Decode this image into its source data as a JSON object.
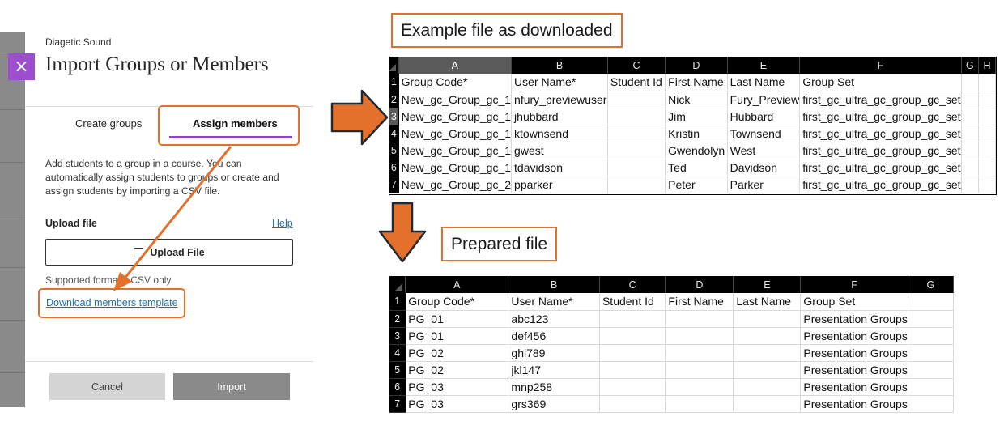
{
  "panel": {
    "course_name": "Diagetic Sound",
    "title": "Import Groups or Members",
    "close_icon": "×",
    "tabs": [
      {
        "label": "Create groups"
      },
      {
        "label": "Assign members"
      }
    ],
    "description": "Add students to a group in a course. You can automatically assign students to groups or create and assign students by importing a CSV file.",
    "upload_label": "Upload file",
    "help_label": "Help",
    "upload_button_label": "Upload File",
    "supported_formats": "Supported formats: CSV only",
    "download_link": "Download members template",
    "cancel_label": "Cancel",
    "import_label": "Import",
    "accent_color": "#8e44c9",
    "highlight_color": "#e3712b"
  },
  "callouts": {
    "top": "Example file as downloaded",
    "bottom": "Prepared file"
  },
  "example_sheet": {
    "columns": [
      "A",
      "B",
      "C",
      "D",
      "E",
      "F",
      "G",
      "H"
    ],
    "rows": [
      [
        "Group Code*",
        "User Name*",
        "Student Id",
        "First Name",
        "Last Name",
        "Group Set",
        "",
        ""
      ],
      [
        "New_gc_Group_gc_1",
        "nfury_previewuser",
        "",
        "Nick",
        "Fury_Preview",
        "first_gc_ultra_gc_group_gc_set",
        "",
        ""
      ],
      [
        "New_gc_Group_gc_1",
        "jhubbard",
        "",
        "Jim",
        "Hubbard",
        "first_gc_ultra_gc_group_gc_set",
        "",
        ""
      ],
      [
        "New_gc_Group_gc_1",
        "ktownsend",
        "",
        "Kristin",
        "Townsend",
        "first_gc_ultra_gc_group_gc_set",
        "",
        ""
      ],
      [
        "New_gc_Group_gc_1",
        "gwest",
        "",
        "Gwendolyn",
        "West",
        "first_gc_ultra_gc_group_gc_set",
        "",
        ""
      ],
      [
        "New_gc_Group_gc_1",
        "tdavidson",
        "",
        "Ted",
        "Davidson",
        "first_gc_ultra_gc_group_gc_set",
        "",
        ""
      ],
      [
        "New_gc_Group_gc_2",
        "pparker",
        "",
        "Peter",
        "Parker",
        "first_gc_ultra_gc_group_gc_set",
        "",
        ""
      ]
    ]
  },
  "prepared_sheet": {
    "columns": [
      "A",
      "B",
      "C",
      "D",
      "E",
      "F",
      "G"
    ],
    "rows": [
      [
        "Group Code*",
        "User Name*",
        "Student Id",
        "First Name",
        "Last Name",
        "Group Set",
        ""
      ],
      [
        "PG_01",
        "abc123",
        "",
        "",
        "",
        "Presentation Groups",
        ""
      ],
      [
        "PG_01",
        "def456",
        "",
        "",
        "",
        "Presentation Groups",
        ""
      ],
      [
        "PG_02",
        "ghi789",
        "",
        "",
        "",
        "Presentation Groups",
        ""
      ],
      [
        "PG_02",
        "jkl147",
        "",
        "",
        "",
        "Presentation Groups",
        ""
      ],
      [
        "PG_03",
        "mnp258",
        "",
        "",
        "",
        "Presentation Groups",
        ""
      ],
      [
        "PG_03",
        "grs369",
        "",
        "",
        "",
        "Presentation Groups",
        ""
      ]
    ]
  }
}
